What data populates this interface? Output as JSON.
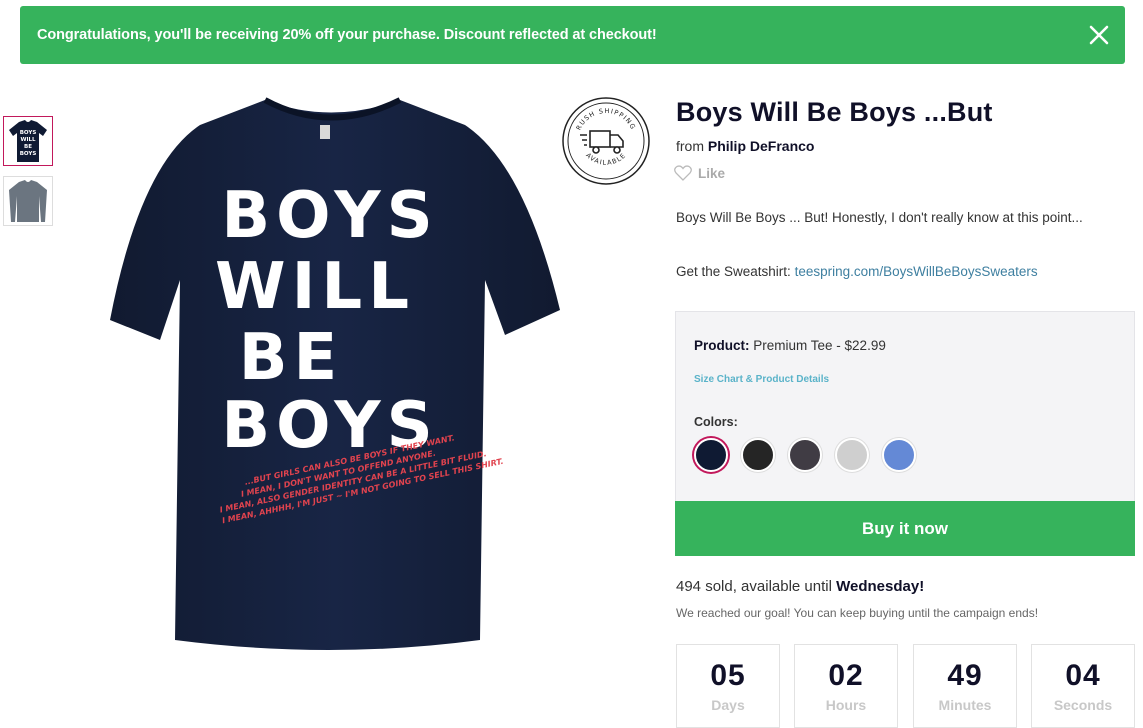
{
  "banner": {
    "message": "Congratulations, you'll be receiving 20% off your purchase. Discount reflected at checkout!",
    "close_icon": "close-icon"
  },
  "product": {
    "title": "Boys Will Be Boys ...But",
    "from_label": "from",
    "creator": "Philip DeFranco",
    "like_label": "Like",
    "description_line1": "Boys Will Be Boys ... But! Honestly, I don't really know at this point...",
    "description_line2_prefix": "Get the Sweatshirt:",
    "description_link": "teespring.com/BoysWillBeBoysSweaters",
    "badge_text_top": "RUSH SHIPPING",
    "badge_text_bottom": "AVAILABLE"
  },
  "shirt": {
    "lines": [
      "BOYS",
      "WILL",
      "BE",
      "BOYS"
    ],
    "fine_print": [
      "...BUT GIRLS CAN ALSO BE BOYS IF THEY WANT.",
      "I MEAN, I DON'T WANT TO OFFEND ANYONE.",
      "I MEAN, ALSO GENDER IDENTITY CAN BE A LITTLE BIT FLUID.",
      "I MEAN, AHHHH, I'M JUST ~ I'M NOT GOING TO SELL THIS SHIRT."
    ]
  },
  "options": {
    "product_label": "Product:",
    "product_value": "Premium Tee - $22.99",
    "size_chart_link": "Size Chart & Product Details",
    "colors_label": "Colors:",
    "colors": [
      "#0f1a33",
      "#252525",
      "#403c44",
      "#cfcfcf",
      "#6489d6"
    ],
    "selected_color_index": 0
  },
  "buy_button": "Buy it now",
  "sales": {
    "sold_text": "494 sold, available until",
    "until_day": "Wednesday!",
    "goal_text": "We reached our goal! You can keep buying until the campaign ends!"
  },
  "countdown": [
    {
      "value": "05",
      "label": "Days"
    },
    {
      "value": "02",
      "label": "Hours"
    },
    {
      "value": "49",
      "label": "Minutes"
    },
    {
      "value": "04",
      "label": "Seconds"
    }
  ],
  "colors": {
    "accent_green": "#36b35c",
    "brand_navy": "#101028",
    "selected_ring": "#c2185b",
    "link_blue": "#3e7fa0"
  }
}
